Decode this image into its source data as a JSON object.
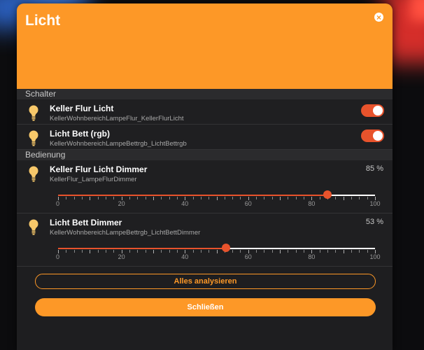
{
  "dialog": {
    "title": "Licht",
    "close_icon": "close-icon"
  },
  "colors": {
    "accent": "#fd9827",
    "toggle_on": "#e8532c",
    "background": "#1e1e20"
  },
  "sections": {
    "switches_title": "Schalter",
    "controls_title": "Bedienung"
  },
  "switches": [
    {
      "title": "Keller Flur Licht",
      "subtitle": "KellerWohnbereichLampeFlur_KellerFlurLicht",
      "on": true,
      "icon": "lightbulb-icon"
    },
    {
      "title": "Licht Bett (rgb)",
      "subtitle": "KellerWohnbereichLampeBettrgb_LichtBettrgb",
      "on": true,
      "icon": "lightbulb-icon"
    }
  ],
  "dimmers": [
    {
      "title": "Keller Flur Licht Dimmer",
      "subtitle": "KellerFlur_LampeFlurDimmer",
      "percent_label": "85 %",
      "value": 85,
      "icon": "lightbulb-icon"
    },
    {
      "title": "Licht Bett Dimmer",
      "subtitle": "KellerWohnbereichLampeBettrgb_LichtBettDimmer",
      "percent_label": "53 %",
      "value": 53,
      "icon": "lightbulb-icon"
    }
  ],
  "slider_scale": {
    "min": 0,
    "max": 100,
    "labels": [
      "0",
      "20",
      "40",
      "60",
      "80",
      "100"
    ]
  },
  "buttons": {
    "analyze_label": "Alles analysieren",
    "close_label": "Schließen"
  }
}
